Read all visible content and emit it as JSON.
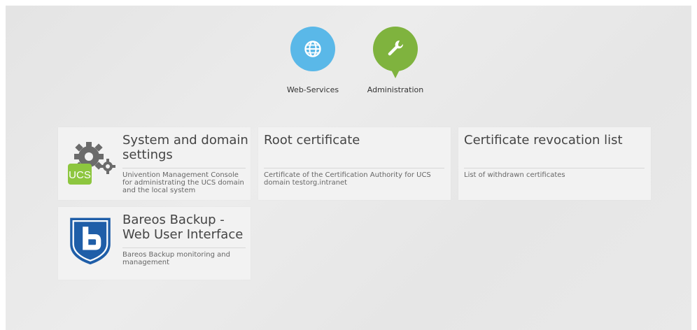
{
  "categories": [
    {
      "id": "web",
      "label": "Web-Services",
      "icon": "globe-icon",
      "color": "#5ab8e8"
    },
    {
      "id": "admin",
      "label": "Administration",
      "icon": "wrench-icon",
      "color": "#7fb33e"
    }
  ],
  "tiles": [
    {
      "title": "System and domain settings",
      "description": "Univention Management Console for administrating the UCS domain and the local system",
      "logo": "ucs-gears-logo"
    },
    {
      "title": "Root certificate",
      "description": "Certificate of the Certification Authority for UCS domain testorg.intranet"
    },
    {
      "title": "Certificate revocation list",
      "description": "List of withdrawn certificates"
    },
    {
      "title": "Bareos Backup - Web User Interface",
      "description": "Bareos Backup monitoring and management",
      "logo": "bareos-shield-logo"
    }
  ],
  "logos": {
    "ucs_text": "UCS"
  },
  "colors": {
    "ucs_green": "#8dc63f",
    "gear_gray": "#6b6b6b",
    "bareos_blue": "#1f5ea8"
  }
}
